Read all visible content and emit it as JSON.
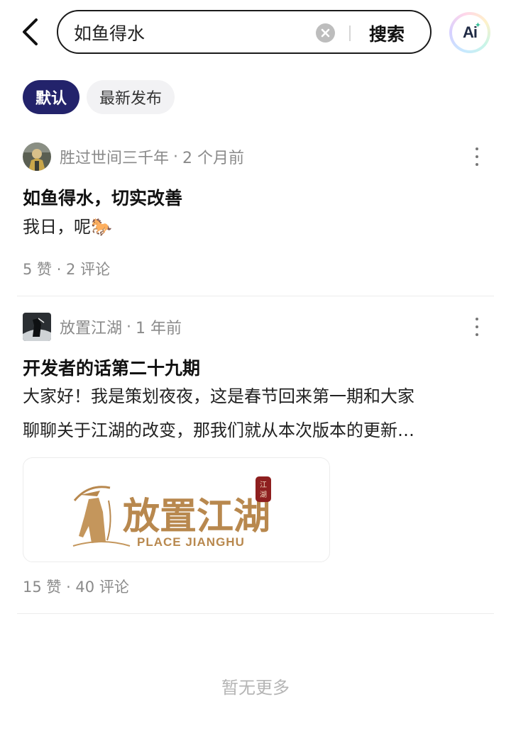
{
  "header": {
    "search_value": "如鱼得水",
    "search_button": "搜索",
    "ai_label": "Ai"
  },
  "tabs": [
    {
      "label": "默认",
      "active": true
    },
    {
      "label": "最新发布",
      "active": false
    }
  ],
  "posts": [
    {
      "author": "胜过世间三千年",
      "time": "2 个月前",
      "title": "如鱼得水，切实改善",
      "body": "我日，呢🐎",
      "stats": "5 赞 · 2 评论"
    },
    {
      "author": "放置江湖",
      "time": "1 年前",
      "title": "开发者的话第二十九期",
      "body_line1": "大家好！我是策划夜夜，这是春节回来第一期和大家",
      "body_line2": "聊聊关于江湖的改变，那我们就从本次版本的更新…",
      "image": {
        "logo_text": "放置江湖",
        "logo_sub": "PLACE JIANGHU",
        "seal_text": "江湖"
      },
      "stats": "15 赞 · 40 评论"
    }
  ],
  "footer": {
    "no_more": "暂无更多"
  },
  "colors": {
    "accent": "#23236b",
    "logo_gold": "#b8884e",
    "seal_red": "#8e1f1f"
  }
}
